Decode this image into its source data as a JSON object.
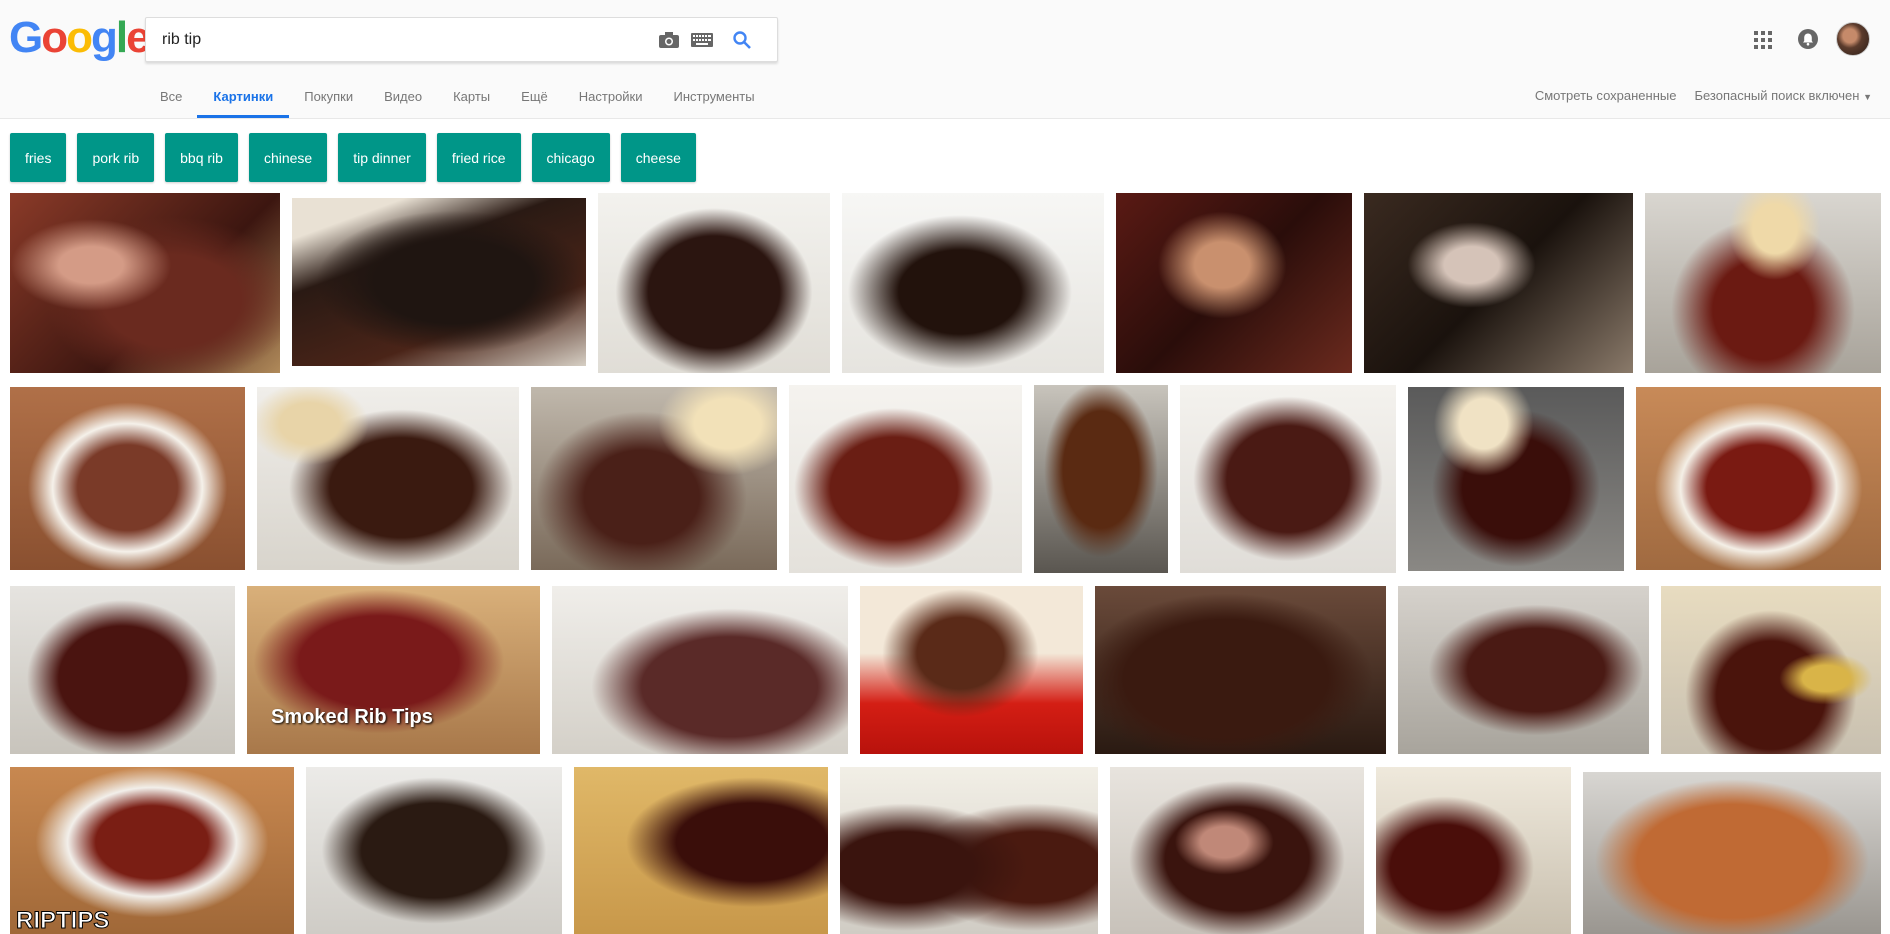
{
  "search": {
    "query": "rib tip"
  },
  "logo": {
    "letters": [
      "G",
      "o",
      "o",
      "g",
      "l",
      "e"
    ],
    "colors": [
      "#4285f4",
      "#ea4335",
      "#fbbc05",
      "#4285f4",
      "#34a853",
      "#ea4335"
    ]
  },
  "tabs": [
    {
      "label": "Все"
    },
    {
      "label": "Картинки"
    },
    {
      "label": "Покупки"
    },
    {
      "label": "Видео"
    },
    {
      "label": "Карты"
    },
    {
      "label": "Ещё"
    },
    {
      "label": "Настройки"
    },
    {
      "label": "Инструменты"
    }
  ],
  "header_right": {
    "saved": "Смотреть сохраненные",
    "safesearch": "Безопасный поиск включен"
  },
  "chips": [
    "fries",
    "pork rib",
    "bbq rib",
    "chinese",
    "tip dinner",
    "fried rice",
    "chicago",
    "cheese"
  ],
  "watermarks": {
    "smoked": "Smoked Rib Tips",
    "riptips": "RIPTIPS"
  },
  "colors": {
    "accent": "#1a73e8",
    "chip": "#009688"
  }
}
